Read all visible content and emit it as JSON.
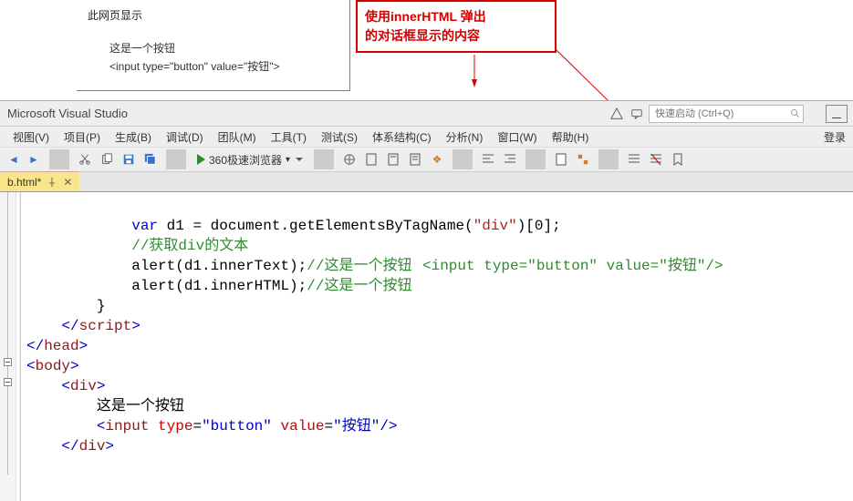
{
  "dialog": {
    "heading": "此网页显示",
    "line1": "这是一个按钮",
    "line2": "<input type=\"button\" value=\"按钮\">"
  },
  "callout": {
    "line1": "使用innerHTML 弹出",
    "line2": "的对话框显示的内容"
  },
  "vs": {
    "title": "Microsoft Visual Studio",
    "quicklaunch_placeholder": "快速启动 (Ctrl+Q)",
    "login": "登录",
    "menu": {
      "view": "视图(V)",
      "project": "项目(P)",
      "build": "生成(B)",
      "debug": "调试(D)",
      "team": "团队(M)",
      "tools": "工具(T)",
      "test": "测试(S)",
      "arch": "体系结构(C)",
      "analyze": "分析(N)",
      "window": "窗口(W)",
      "help": "帮助(H)"
    },
    "toolbar": {
      "run_target": "360极速浏览器"
    },
    "tab": {
      "label": "b.html*"
    }
  },
  "code": {
    "l1a": "var",
    "l1b": " d1 = document.getElementsByTagName(",
    "l1c": "\"div\"",
    "l1d": ")[0];",
    "l2": "//获取div的文本",
    "l3a": "alert(d1.innerText);",
    "l3b": "//这是一个按钮",
    "l4a": "alert(d1.innerHTML);",
    "l4b": "//这是一个按钮",
    "inline": "<input type=\"button\" value=\"按钮\"/>",
    "l5": "}",
    "l6a": "</",
    "l6b": "script",
    "l6c": ">",
    "l7a": "</",
    "l7b": "head",
    "l7c": ">",
    "l8a": "<",
    "l8b": "body",
    "l8c": ">",
    "l9a": "<",
    "l9b": "div",
    "l9c": ">",
    "l10": "这是一个按钮",
    "l11a": "<",
    "l11b": "input",
    "l11c": " ",
    "l11d": "type",
    "l11e": "=",
    "l11f": "\"button\"",
    "l11g": " ",
    "l11h": "value",
    "l11i": "=",
    "l11j": "\"按钮\"",
    "l11k": "/>",
    "l12a": "</",
    "l12b": "div",
    "l12c": ">"
  }
}
